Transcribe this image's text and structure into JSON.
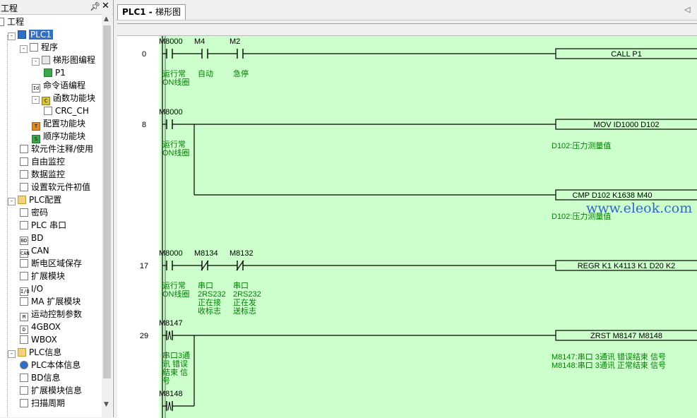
{
  "tree": {
    "title": "工程",
    "pin_glyph": "ᵩ",
    "close_glyph": "✕",
    "items": [
      {
        "label": "工程",
        "icon": "project-icon",
        "selected": false
      },
      {
        "label": "PLC1",
        "icon": "plc-icon",
        "selected": true
      },
      {
        "label": "程序",
        "icon": "program-icon"
      },
      {
        "label": "梯形图编程",
        "icon": "ladder-icon"
      },
      {
        "label": "P1",
        "icon": "ladder-page-icon"
      },
      {
        "label": "命令语编程",
        "icon": "instruction-icon"
      },
      {
        "label": "函数功能块",
        "icon": "function-block-icon"
      },
      {
        "label": "CRC_CH",
        "icon": "document-icon"
      },
      {
        "label": "配置功能块",
        "icon": "config-block-icon"
      },
      {
        "label": "顺序功能块",
        "icon": "sequence-block-icon"
      },
      {
        "label": "软元件注释/使用",
        "icon": "comment-icon"
      },
      {
        "label": "自由监控",
        "icon": "free-monitor-icon"
      },
      {
        "label": "数据监控",
        "icon": "data-monitor-icon"
      },
      {
        "label": "设置软元件初值",
        "icon": "initial-value-icon"
      },
      {
        "label": "PLC配置",
        "icon": "folder-icon"
      },
      {
        "label": "密码",
        "icon": "password-icon"
      },
      {
        "label": "PLC 串口",
        "icon": "serial-port-icon"
      },
      {
        "label": "BD",
        "icon": "bd-icon"
      },
      {
        "label": "CAN",
        "icon": "can-icon"
      },
      {
        "label": "断电区域保存",
        "icon": "power-save-icon"
      },
      {
        "label": "扩展模块",
        "icon": "expansion-module-icon"
      },
      {
        "label": "I/O",
        "icon": "io-icon"
      },
      {
        "label": "MA 扩展模块",
        "icon": "ma-module-icon"
      },
      {
        "label": "运动控制参数",
        "icon": "motion-icon"
      },
      {
        "label": "4GBOX",
        "icon": "4gbox-icon"
      },
      {
        "label": "WBOX",
        "icon": "wbox-icon"
      },
      {
        "label": "PLC信息",
        "icon": "folder-icon"
      },
      {
        "label": "PLC本体信息",
        "icon": "info-icon"
      },
      {
        "label": "BD信息",
        "icon": "bd-info-icon"
      },
      {
        "label": "扩展模块信息",
        "icon": "module-info-icon"
      },
      {
        "label": "扫描周期",
        "icon": "scan-cycle-icon"
      }
    ]
  },
  "editor": {
    "tab_label_prefix": "PLC1 - ",
    "tab_label_main": "梯形图",
    "scroll_left_glyph": "◁",
    "watermark": "www.eleok.com"
  },
  "ladder": {
    "rungs": [
      {
        "step": "0",
        "contacts": [
          {
            "name": "M8000",
            "type": "NO"
          },
          {
            "name": "M4",
            "type": "NO"
          },
          {
            "name": "M2",
            "type": "NO"
          }
        ],
        "instruction": "CALL     P1",
        "contact_comments": [
          [
            "运行常",
            "ON线圈"
          ],
          [
            "自动"
          ],
          [
            "急停"
          ]
        ],
        "instruction_comments": []
      },
      {
        "step": "8",
        "contacts": [
          {
            "name": "M8000",
            "type": "NO"
          }
        ],
        "instruction": "MOV     ID1000  D102",
        "contact_comments": [
          [
            "运行常",
            "ON线圈"
          ]
        ],
        "instruction_comments": [
          "D102:压力测量值"
        ],
        "branch_instruction": "CMP      D102     K1638   M40",
        "branch_comments": [
          "D102:压力测量值"
        ]
      },
      {
        "step": "17",
        "contacts": [
          {
            "name": "M8000",
            "type": "NO"
          },
          {
            "name": "M8134",
            "type": "NC"
          },
          {
            "name": "M8132",
            "type": "NC"
          }
        ],
        "instruction": "REGR K1 K4113 K1 D20 K2",
        "contact_comments": [
          [
            "运行常",
            "ON线圈"
          ],
          [
            "串口",
            "2RS232",
            "正在接",
            "收标志"
          ],
          [
            "串口",
            "2RS232",
            "正在发",
            "送标志"
          ]
        ],
        "instruction_comments": []
      },
      {
        "step": "29",
        "contacts": [
          {
            "name": "M8147",
            "type": "P"
          }
        ],
        "instruction": "ZRST     M8147   M8148",
        "contact_comments": [
          [
            "串口3通",
            "讯 错误",
            "结束 信",
            "号"
          ]
        ],
        "instruction_comments": [
          "M8147:串口 3通讯 错误结束 信号",
          "M8148:串口 3通讯 正常结束 信号"
        ],
        "parallel_contact": {
          "name": "M8148",
          "type": "P"
        }
      }
    ]
  },
  "colors": {
    "ladder_bg": "#ccffcc",
    "comment_text": "#008000",
    "selected_bg": "#3370c8"
  }
}
